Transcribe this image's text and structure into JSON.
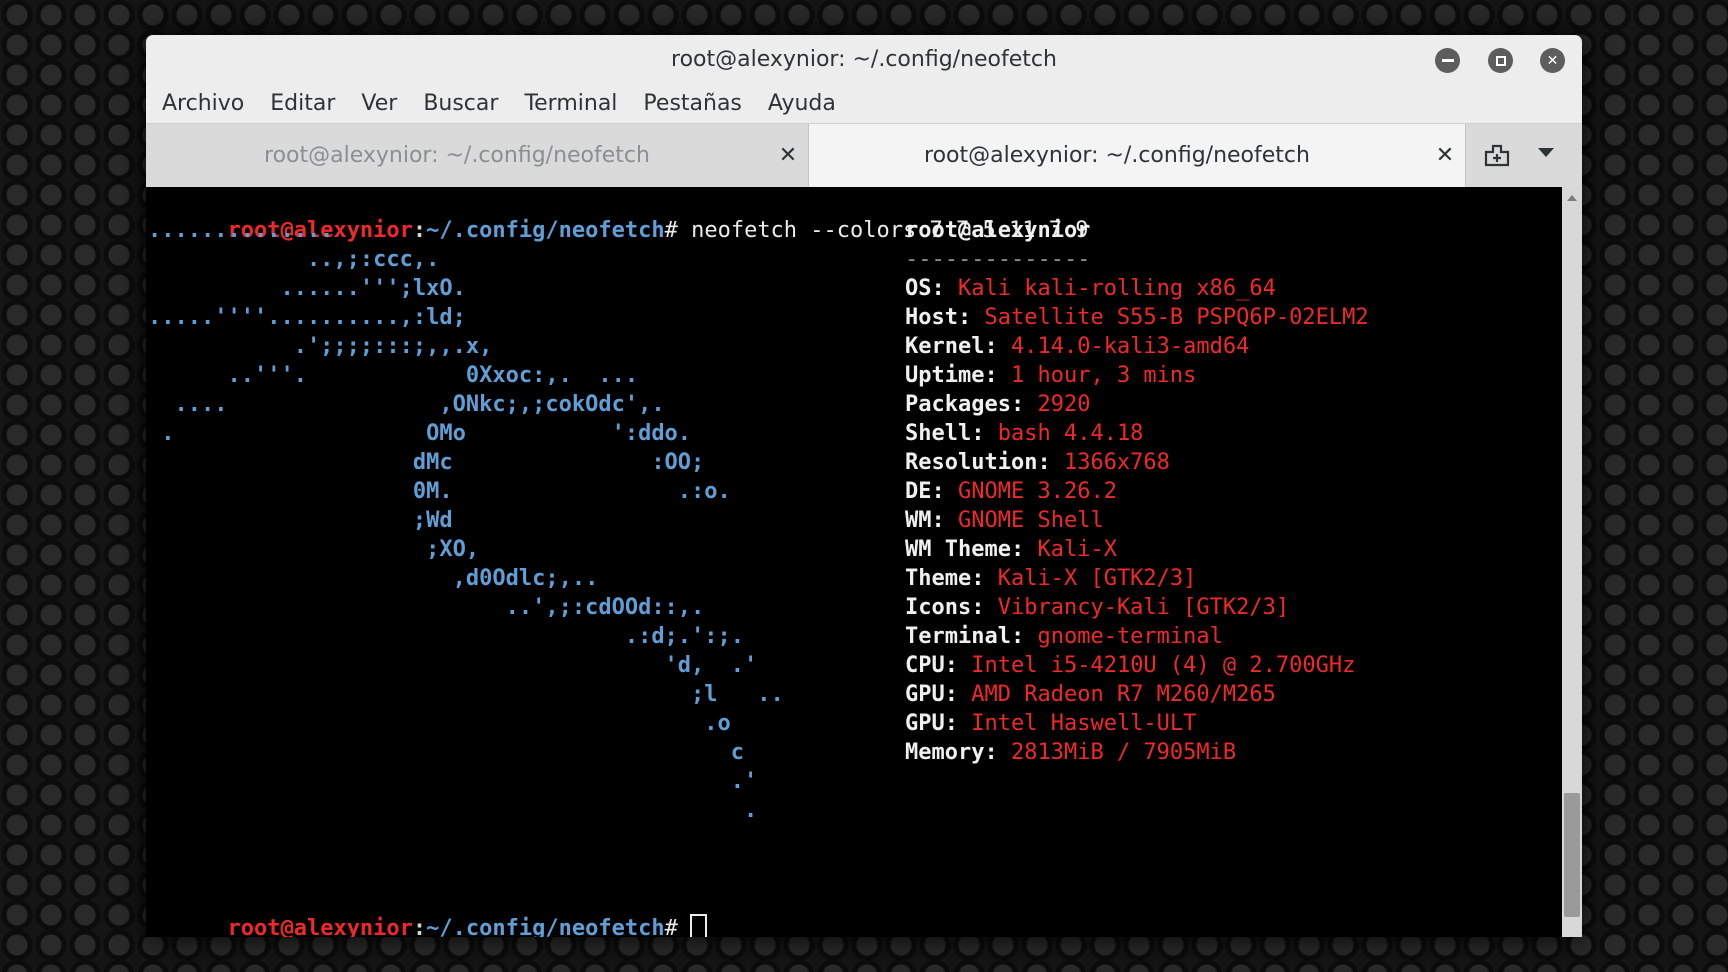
{
  "window": {
    "title": "root@alexynior: ~/.config/neofetch",
    "controls": [
      "minimize-icon",
      "maximize-icon",
      "close-icon"
    ],
    "close_glyph": "✕"
  },
  "menu": [
    "Archivo",
    "Editar",
    "Ver",
    "Buscar",
    "Terminal",
    "Pestañas",
    "Ayuda"
  ],
  "tabs": [
    {
      "label": "root@alexynior: ~/.config/neofetch",
      "active": false,
      "close": "✕"
    },
    {
      "label": "root@alexynior: ~/.config/neofetch",
      "active": true,
      "close": "✕"
    }
  ],
  "terminal": {
    "prompt_user": "root@alexynior",
    "prompt_sep": ":",
    "prompt_path": "~/.config/neofetch",
    "prompt_end": "#",
    "command": " neofetch --colors 7 7 5 11 7 9",
    "ascii_art": [
      "..............",
      "            ..,;:ccc,.",
      "          ......''';lxO.",
      ".....''''..........,:ld;",
      "           .';;;;:::;,,.x,",
      "      ..'''.            0Xxoc:,.  ...",
      "  ....                ,ONkc;,;cokOdc',.",
      " .                   OMo           ':ddo.",
      "                    dMc               :OO;",
      "                    0M.                 .:o.",
      "                    ;Wd",
      "                     ;XO,",
      "                       ,d0Odlc;,..",
      "                           ..',;:cdOOd::,.",
      "                                    .:d;.':;.",
      "                                       'd,  .'",
      "                                         ;l   ..",
      "                                          .o",
      "                                            c",
      "                                            .'",
      "                                             ."
    ],
    "info_title": "root@alexynior",
    "info_underline": "--------------",
    "info": [
      {
        "key": "OS",
        "value": "Kali kali-rolling x86_64"
      },
      {
        "key": "Host",
        "value": "Satellite S55-B PSPQ6P-02ELM2"
      },
      {
        "key": "Kernel",
        "value": "4.14.0-kali3-amd64"
      },
      {
        "key": "Uptime",
        "value": "1 hour, 3 mins"
      },
      {
        "key": "Packages",
        "value": "2920"
      },
      {
        "key": "Shell",
        "value": "bash 4.4.18"
      },
      {
        "key": "Resolution",
        "value": "1366x768"
      },
      {
        "key": "DE",
        "value": "GNOME 3.26.2"
      },
      {
        "key": "WM",
        "value": "GNOME Shell"
      },
      {
        "key": "WM Theme",
        "value": "Kali-X"
      },
      {
        "key": "Theme",
        "value": "Kali-X [GTK2/3]"
      },
      {
        "key": "Icons",
        "value": "Vibrancy-Kali [GTK2/3]"
      },
      {
        "key": "Terminal",
        "value": "gnome-terminal"
      },
      {
        "key": "CPU",
        "value": "Intel i5-4210U (4) @ 2.700GHz"
      },
      {
        "key": "GPU",
        "value": "AMD Radeon R7 M260/M265"
      },
      {
        "key": "GPU",
        "value": "Intel Haswell-ULT"
      },
      {
        "key": "Memory",
        "value": "2813MiB / 7905MiB"
      }
    ],
    "palette": [
      "#2e3436",
      "#e00000",
      "#3cb71a",
      "#d4b800",
      "#2a7ac4",
      "#6e5a9e",
      "#00aeae",
      "#e8e8e8"
    ]
  }
}
